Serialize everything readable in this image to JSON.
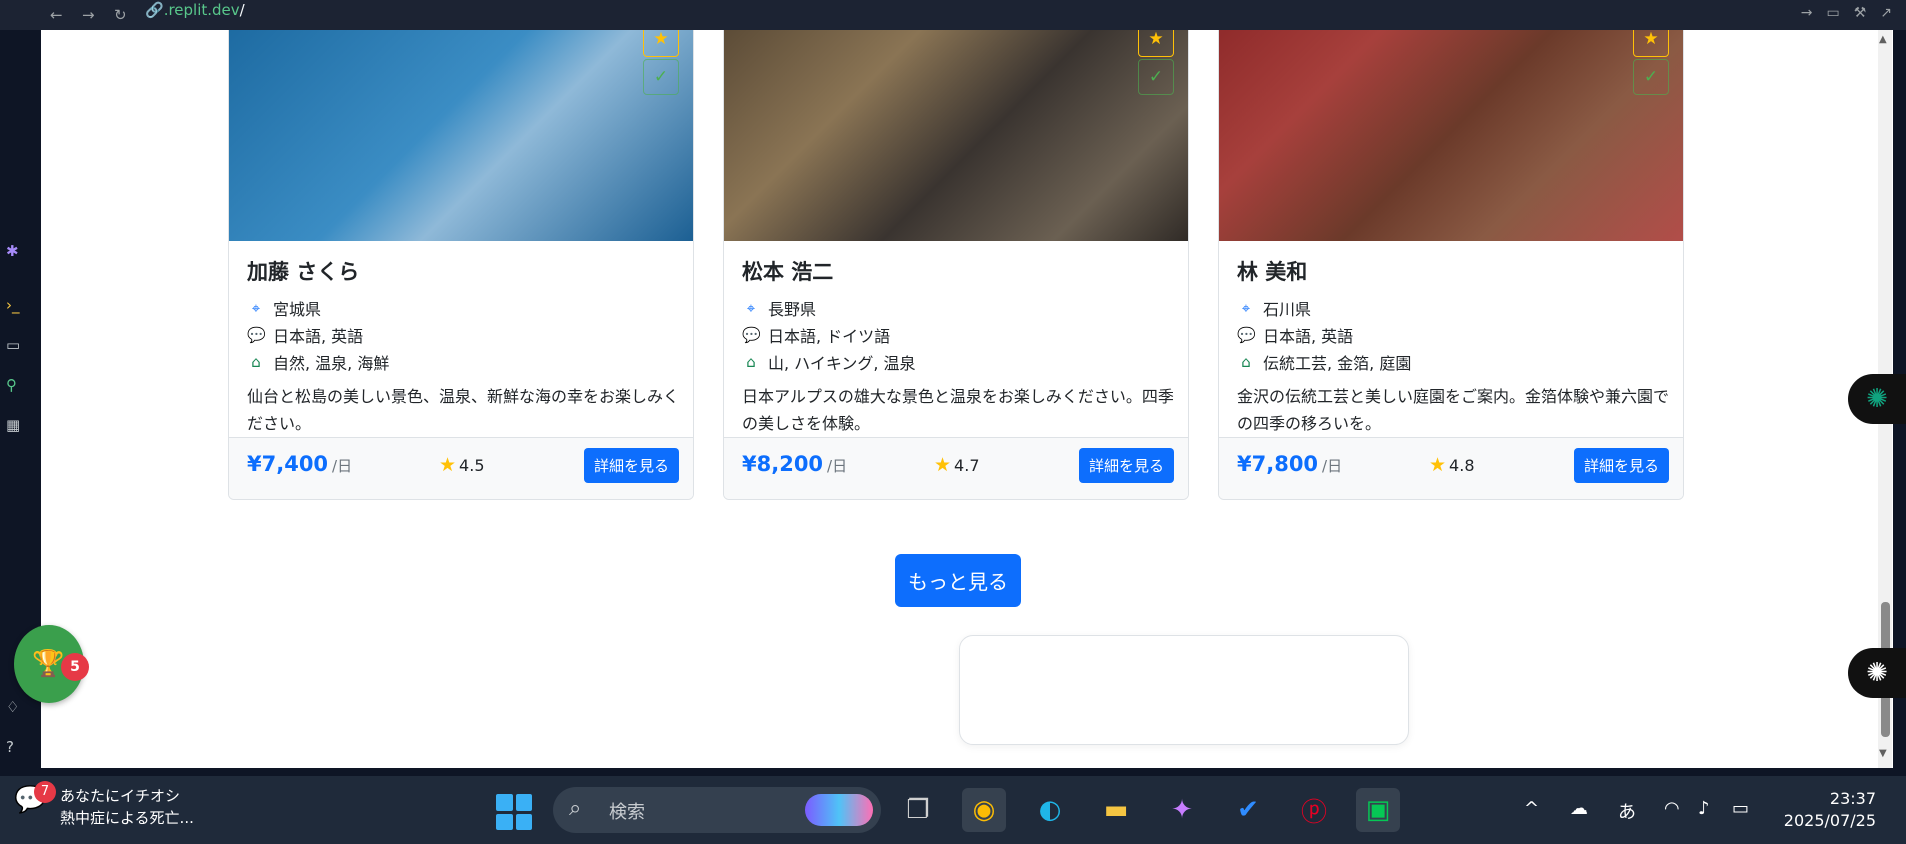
{
  "browser": {
    "url_host": ".replit.dev",
    "url_path": "/"
  },
  "cards": [
    {
      "name": "加藤 さくら",
      "location": "宮城県",
      "languages": "日本語, 英語",
      "interests": "自然, 温泉, 海鮮",
      "description": "仙台と松島の美しい景色、温泉、新鮮な海の幸をお楽しみください。",
      "price": "¥7,400",
      "price_unit": "/日",
      "rating": "4.5",
      "button": "詳細を見る"
    },
    {
      "name": "松本 浩二",
      "location": "長野県",
      "languages": "日本語, ドイツ語",
      "interests": "山, ハイキング, 温泉",
      "description": "日本アルプスの雄大な景色と温泉をお楽しみください。四季の美しさを体験。",
      "price": "¥8,200",
      "price_unit": "/日",
      "rating": "4.7",
      "button": "詳細を見る"
    },
    {
      "name": "林 美和",
      "location": "石川県",
      "languages": "日本語, 英語",
      "interests": "伝統工芸, 金箔, 庭園",
      "description": "金沢の伝統工芸と美しい庭園をご案内。金箔体験や兼六園での四季の移ろいを。",
      "price": "¥7,800",
      "price_unit": "/日",
      "rating": "4.8",
      "button": "詳細を見る"
    }
  ],
  "more_button": "もっと見る",
  "trophy_badge": "5",
  "taskbar": {
    "news_count": "7",
    "news_title": "あなたにイチオシ",
    "news_sub": "熱中症による死亡...",
    "search_placeholder": "検索",
    "ime": "あ",
    "time": "23:37",
    "date": "2025/07/25"
  },
  "colors": {
    "primary": "#0d6efd",
    "star": "#ffc107",
    "taskbar": "#1f2a3a"
  }
}
